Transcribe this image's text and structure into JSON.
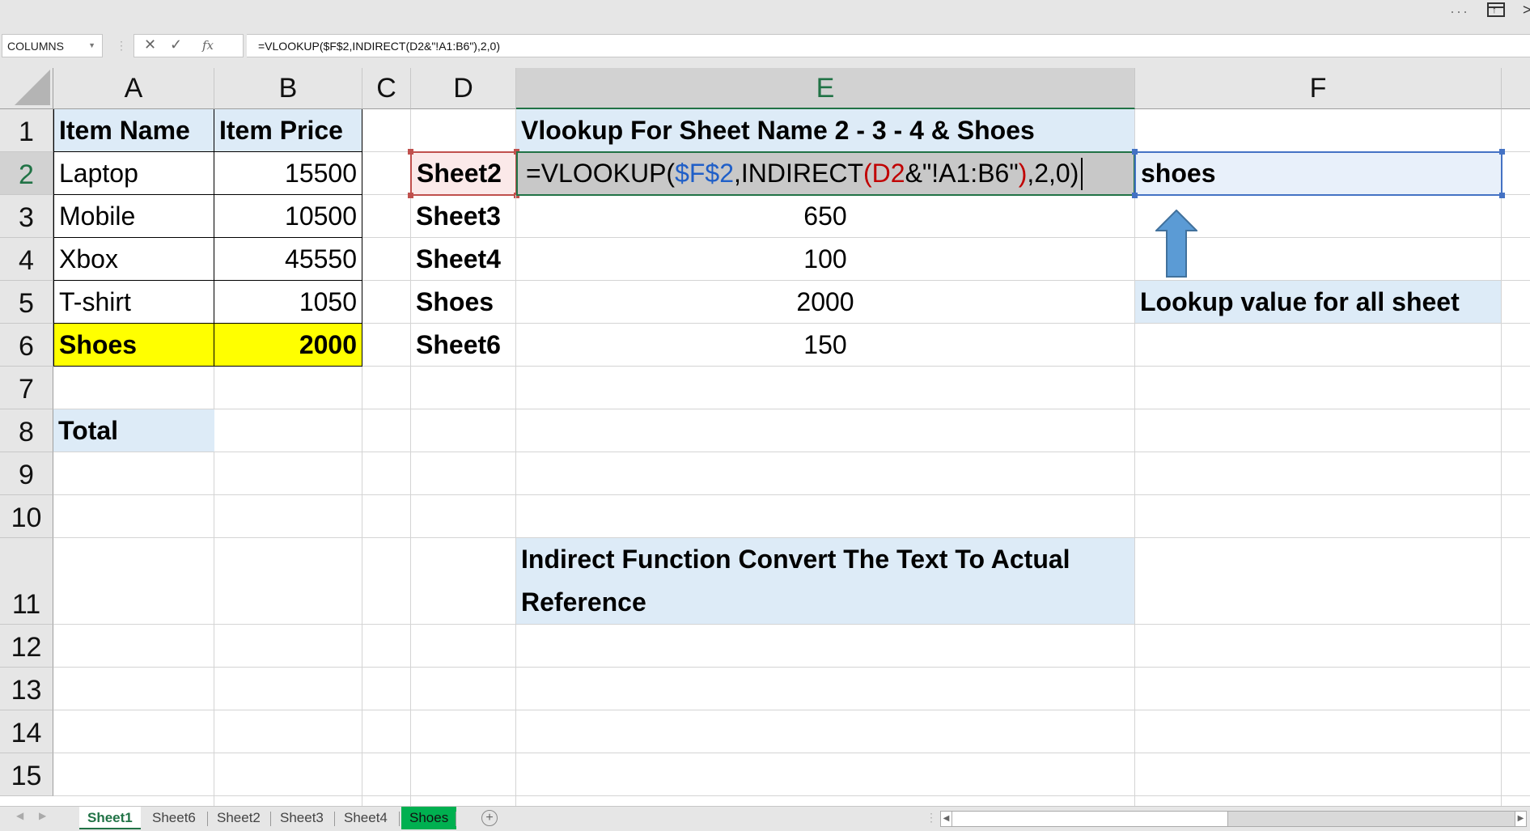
{
  "window": {
    "more_icon": "···",
    "restore_icon": "ribbon-display-icon",
    "close_icon": "close-icon"
  },
  "formula_bar": {
    "name_box": "COLUMNS",
    "cancel_icon": "✕",
    "enter_icon": "✓",
    "fx_icon": "fx",
    "formula": "=VLOOKUP($F$2,INDIRECT(D2&\"!A1:B6\"),2,0)"
  },
  "columns": [
    "A",
    "B",
    "C",
    "D",
    "E",
    "F"
  ],
  "rows": [
    "1",
    "2",
    "3",
    "4",
    "5",
    "6",
    "7",
    "8",
    "9",
    "10",
    "11",
    "12",
    "13",
    "14",
    "15"
  ],
  "selected": {
    "column": "E",
    "row": "2"
  },
  "colors": {
    "accent": "#217346",
    "header_fill": "#ddebf7",
    "highlight_fill": "#ffff00",
    "ref_red": "#c00000",
    "ref_blue": "#1f5fc8",
    "arrow": "#5b9bd5",
    "shoes_tab": "#00b050"
  },
  "table": {
    "headers": [
      "Item Name",
      "Item Price"
    ],
    "rows": [
      {
        "name": "Laptop",
        "price": "15500"
      },
      {
        "name": "Mobile",
        "price": "10500"
      },
      {
        "name": "Xbox",
        "price": "45550"
      },
      {
        "name": "T-shirt",
        "price": "1050"
      },
      {
        "name": "Shoes",
        "price": "2000"
      }
    ],
    "total_label": "Total"
  },
  "lookup": {
    "title": "Vlookup For Sheet Name 2 - 3 - 4 & Shoes",
    "sheets": [
      "Sheet2",
      "Sheet3",
      "Sheet4",
      "Shoes",
      "Sheet6"
    ],
    "formula_parts": {
      "p1": "=VLOOKUP(",
      "p2": "$F$2",
      "p3": ",INDIRECT",
      "p4": "(",
      "p5": "D2",
      "p6": "&\"!A1:B6\"",
      "p7": ")",
      "p8": ",2,0)"
    },
    "results": [
      "650",
      "100",
      "2000",
      "150"
    ],
    "lookup_value": "shoes",
    "lookup_note": "Lookup value for all sheet",
    "indirect_note": "Indirect Function Convert The Text To Actual Reference"
  },
  "tabs": {
    "items": [
      {
        "label": "Sheet1",
        "state": "active"
      },
      {
        "label": "Sheet6",
        "state": "normal"
      },
      {
        "label": "Sheet2",
        "state": "normal"
      },
      {
        "label": "Sheet3",
        "state": "normal"
      },
      {
        "label": "Sheet4",
        "state": "normal"
      },
      {
        "label": "Shoes",
        "state": "green"
      }
    ],
    "add_label": "+",
    "prev": "◀",
    "next": "▶"
  }
}
